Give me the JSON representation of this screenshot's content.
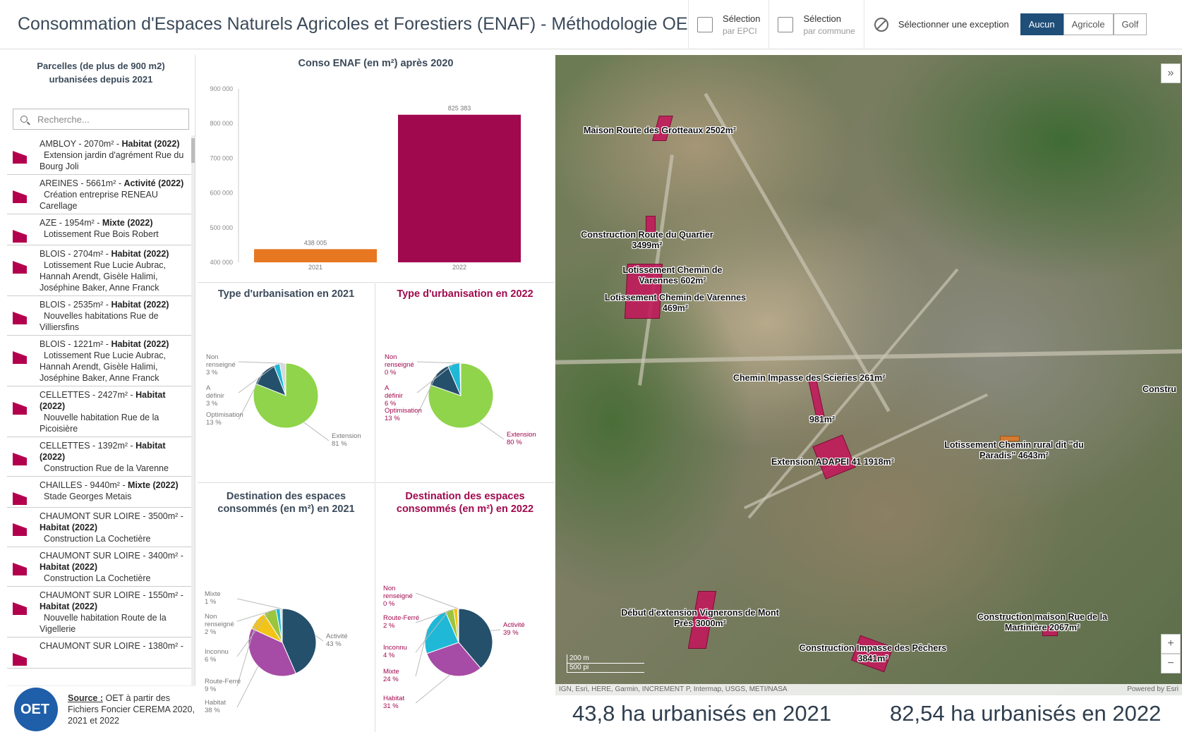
{
  "header": {
    "title": "Consommation d'Espaces Naturels Agricoles et Forestiers (ENAF) - Méthodologie OET",
    "sel_epci_line1": "Sélection",
    "sel_epci_line2": "par EPCI",
    "sel_commune_line1": "Sélection",
    "sel_commune_line2": "par commune",
    "exception_label": "Sélectionner une exception",
    "exception_options": [
      "Aucun",
      "Agricole",
      "Golf"
    ],
    "exception_selected": "Aucun"
  },
  "list_panel": {
    "title": "Parcelles (de plus de 900 m2) urbanisées depuis 2021",
    "search_placeholder": "Recherche...",
    "items": [
      {
        "head": "AMBLOY - 2070m² - ",
        "type": "Habitat",
        "year": "(2022)",
        "desc": "Extension jardin d'agrément Rue du Bourg Joli"
      },
      {
        "head": "AREINES - 5661m² - ",
        "type": "Activité",
        "year": "(2022)",
        "desc": "Création entreprise RENEAU Carellage"
      },
      {
        "head": "AZE - 1954m² - ",
        "type": "Mixte",
        "year": "(2022)",
        "desc": "Lotissement Rue Bois Robert"
      },
      {
        "head": "BLOIS - 2704m² - ",
        "type": "Habitat",
        "year": "(2022)",
        "desc": "Lotissement Rue Lucie Aubrac, Hannah Arendt, Gisèle Halimi, Joséphine Baker, Anne Franck"
      },
      {
        "head": "BLOIS - 2535m² - ",
        "type": "Habitat",
        "year": "(2022)",
        "desc": "Nouvelles habitations Rue de Villiersfins"
      },
      {
        "head": "BLOIS - 1221m² - ",
        "type": "Habitat",
        "year": "(2022)",
        "desc": "Lotissement Rue Lucie Aubrac, Hannah Arendt, Gisèle Halimi, Joséphine Baker, Anne Franck"
      },
      {
        "head": "CELLETTES - 2427m² - ",
        "type": "Habitat",
        "year": "(2022)",
        "desc": "Nouvelle habitation Rue de la Picoisière"
      },
      {
        "head": "CELLETTES - 1392m² - ",
        "type": "Habitat",
        "year": "(2022)",
        "desc": "Construction Rue de la Varenne"
      },
      {
        "head": "CHAILLES - 9440m² - ",
        "type": "Mixte",
        "year": "(2022)",
        "desc": "Stade Georges Metais"
      },
      {
        "head": "CHAUMONT SUR LOIRE - 3500m² - ",
        "type": "Habitat",
        "year": "(2022)",
        "desc": "Construction La Cochetière"
      },
      {
        "head": "CHAUMONT SUR LOIRE - 3400m² - ",
        "type": "Habitat",
        "year": "(2022)",
        "desc": "Construction La Cochetière"
      },
      {
        "head": "CHAUMONT SUR LOIRE - 1550m² - ",
        "type": "Habitat",
        "year": "(2022)",
        "desc": "Nouvelle habitation Route de la Vigellerie"
      },
      {
        "head": "CHAUMONT SUR LOIRE - 1380m² - ",
        "type": "",
        "year": "",
        "desc": ""
      }
    ],
    "source_label": "Source :",
    "source_text": "OET à partir des Fichiers Foncier CEREMA 2020, 2021 et 2022",
    "logo_text": "OET"
  },
  "bar_panel": {
    "title": "Conso ENAF (en m²) après 2020"
  },
  "pie_panels": {
    "type2021_title": "Type d'urbanisation en 2021",
    "type2022_title": "Type d'urbanisation en 2022",
    "dest2021_title": "Destination des espaces consommés (en m²) en 2021",
    "dest2022_title": "Destination des espaces consommés (en m²) en 2022"
  },
  "chart_data": [
    {
      "type": "bar",
      "title": "Conso ENAF (en m²) après 2020",
      "categories": [
        "2021",
        "2022"
      ],
      "values": [
        438005,
        825383
      ],
      "value_labels": [
        "438 005",
        "825 383"
      ],
      "ylim": [
        400000,
        900000
      ],
      "yticks": [
        "900 000",
        "800 000",
        "700 000",
        "600 000",
        "500 000",
        "400 000"
      ],
      "colors": [
        "#e87722",
        "#a0094e"
      ]
    },
    {
      "type": "pie",
      "title": "Type d'urbanisation en 2021",
      "slices": [
        {
          "label": "Extension",
          "pct": "81 %",
          "value": 81,
          "color": "#8fd44a"
        },
        {
          "label": "Optimisation",
          "pct": "13 %",
          "value": 13,
          "color": "#24506b"
        },
        {
          "label": "A définir",
          "pct": "3 %",
          "value": 3,
          "color": "#1fb8d6"
        },
        {
          "label": "Non renseigné",
          "pct": "3 %",
          "value": 3,
          "color": "#d8d8d8"
        }
      ]
    },
    {
      "type": "pie",
      "title": "Type d'urbanisation en 2022",
      "slices": [
        {
          "label": "Extension",
          "pct": "80 %",
          "value": 80,
          "color": "#8fd44a"
        },
        {
          "label": "Optimisation",
          "pct": "13 %",
          "value": 13,
          "color": "#24506b"
        },
        {
          "label": "A définir",
          "pct": "6 %",
          "value": 6,
          "color": "#1fb8d6"
        },
        {
          "label": "Non renseigné",
          "pct": "0 %",
          "value": 0.5,
          "color": "#d8d8d8"
        }
      ]
    },
    {
      "type": "pie",
      "title": "Destination des espaces consommés (en m²) en 2021",
      "slices": [
        {
          "label": "Activité",
          "pct": "43 %",
          "value": 43,
          "color": "#24506b"
        },
        {
          "label": "Habitat",
          "pct": "38 %",
          "value": 38,
          "color": "#a64ca6"
        },
        {
          "label": "Route-Ferré",
          "pct": "9 %",
          "value": 9,
          "color": "#f2c318"
        },
        {
          "label": "Inconnu",
          "pct": "6 %",
          "value": 6,
          "color": "#9bc53d"
        },
        {
          "label": "Non renseigné",
          "pct": "2 %",
          "value": 2,
          "color": "#1fb8d6"
        },
        {
          "label": "Mixte",
          "pct": "1 %",
          "value": 1,
          "color": "#d8d8d8"
        }
      ]
    },
    {
      "type": "pie",
      "title": "Destination des espaces consommés (en m²) en 2022",
      "slices": [
        {
          "label": "Activité",
          "pct": "39 %",
          "value": 39,
          "color": "#24506b"
        },
        {
          "label": "Habitat",
          "pct": "31 %",
          "value": 31,
          "color": "#a64ca6"
        },
        {
          "label": "Mixte",
          "pct": "24 %",
          "value": 24,
          "color": "#1fb8d6"
        },
        {
          "label": "Inconnu",
          "pct": "4 %",
          "value": 4,
          "color": "#9bc53d"
        },
        {
          "label": "Route-Ferré",
          "pct": "2 %",
          "value": 2,
          "color": "#f2c318"
        },
        {
          "label": "Non renseigné",
          "pct": "0 %",
          "value": 0.5,
          "color": "#d8d8d8"
        }
      ]
    }
  ],
  "map": {
    "labels": [
      "Maison Route des Grotteaux 2502m²",
      "Construction Route du Quartier 3499m²",
      "Lotissement Chemin de Varennes 602m²",
      "Lotissement Chemin de Varennes 469m²",
      "Chemin Impasse des Scieries 261m²",
      "981m²",
      "Extension ADAPEI 41 1918m²",
      "Lotissement Chemin rural dit \"du Paradis\" 4643m²",
      "Début d'extension Vignerons de Mont Près 3000m²",
      "Construction Impasse des Pêchers 3841m²",
      "Construction maison Rue de la Martinière 2067m²",
      "Constru"
    ],
    "scale_m": "200 m",
    "scale_ft": "500 pi",
    "attribution": "IGN, Esri, HERE, Garmin, INCREMENT P, Intermap, USGS, METI/NASA",
    "powered": "Powered by Esri",
    "zoom_in": "+",
    "zoom_out": "−",
    "collapse": "»"
  },
  "kpi": {
    "k2021": "43,8 ha urbanisés en 2021",
    "k2022": "82,54 ha urbanisés en 2022"
  }
}
